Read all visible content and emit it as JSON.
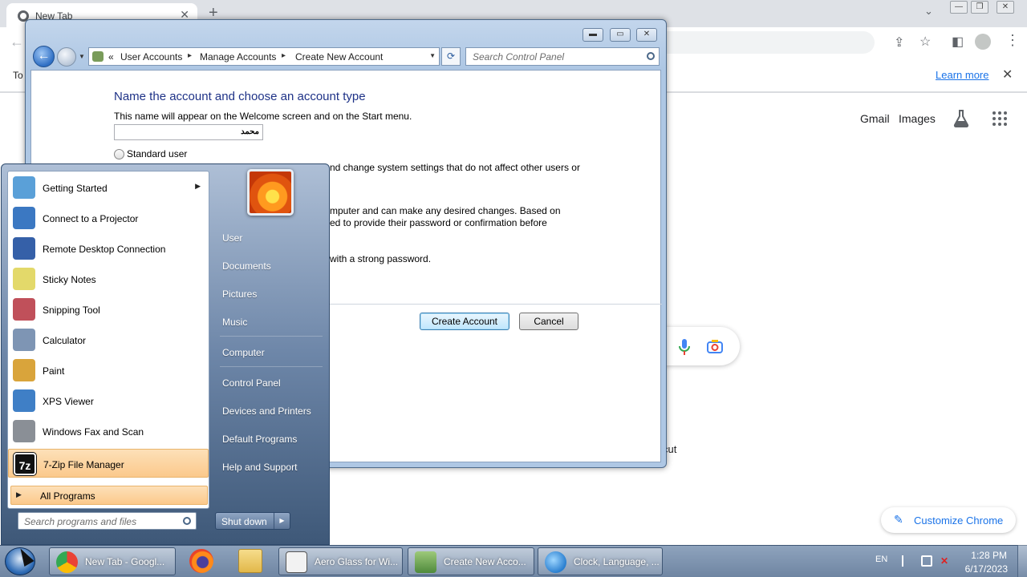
{
  "chrome": {
    "tab_title": "New Tab",
    "tab_close": "✕",
    "new_tab": "+",
    "infobar_text": "To",
    "learn_more": "Learn more",
    "infobar_close": "✕",
    "gmail": "Gmail",
    "images": "Images",
    "cut_text": "cut",
    "customize": "Customize Chrome"
  },
  "control_panel": {
    "breadcrumbs": [
      "User Accounts",
      "Manage Accounts",
      "Create New Account"
    ],
    "crumb_sep": "▸",
    "nav_prefix": "«",
    "search_placeholder": "Search Control Panel",
    "heading": "Name the account and choose an account type",
    "description": "This name will appear on the Welcome screen and on the Start menu.",
    "name_value": "محمد",
    "standard_user_label": "Standard user",
    "standard_desc_tail": "nd change system settings that do not affect other users or",
    "admin_desc_tail_1": "mputer and can make any desired changes. Based on",
    "admin_desc_tail_2": "ed to provide their password or confirmation before",
    "password_tail": "with a strong password.",
    "create_button": "Create Account",
    "cancel_button": "Cancel"
  },
  "start_menu": {
    "programs": [
      {
        "label": "Getting Started",
        "has_submenu": true,
        "color": "#5aa0d8"
      },
      {
        "label": "Connect to a Projector",
        "color": "#3b78c2"
      },
      {
        "label": "Remote Desktop Connection",
        "color": "#3560a8"
      },
      {
        "label": "Sticky Notes",
        "color": "#e3d96a"
      },
      {
        "label": "Snipping Tool",
        "color": "#c0505a"
      },
      {
        "label": "Calculator",
        "color": "#7e95b4"
      },
      {
        "label": "Paint",
        "color": "#d9a43b"
      },
      {
        "label": "XPS Viewer",
        "color": "#3f7fc6"
      },
      {
        "label": "Windows Fax and Scan",
        "color": "#8a8f96"
      },
      {
        "label": "7-Zip File Manager",
        "color": "#111111",
        "highlighted": true
      }
    ],
    "all_programs": "All Programs",
    "all_programs_arrow": "▶",
    "submenu_arrow": "▶",
    "search_placeholder": "Search programs and files",
    "right_items": [
      "User",
      "Documents",
      "Pictures",
      "Music",
      "Computer",
      "Control Panel",
      "Devices and Printers",
      "Default Programs",
      "Help and Support"
    ],
    "shutdown": "Shut down",
    "shutdown_arrow": "▶"
  },
  "taskbar": {
    "buttons": [
      {
        "label": "New Tab - Googl...",
        "icon": "chrome-icon"
      },
      {
        "label": "Aero Glass for Wi...",
        "icon": "app-window-icon"
      },
      {
        "label": "Create New Acco...",
        "icon": "user-accounts-icon"
      },
      {
        "label": "Clock, Language, ...",
        "icon": "globe-clock-icon"
      }
    ],
    "lang": "EN",
    "time": "1:28 PM",
    "date": "6/17/2023"
  }
}
